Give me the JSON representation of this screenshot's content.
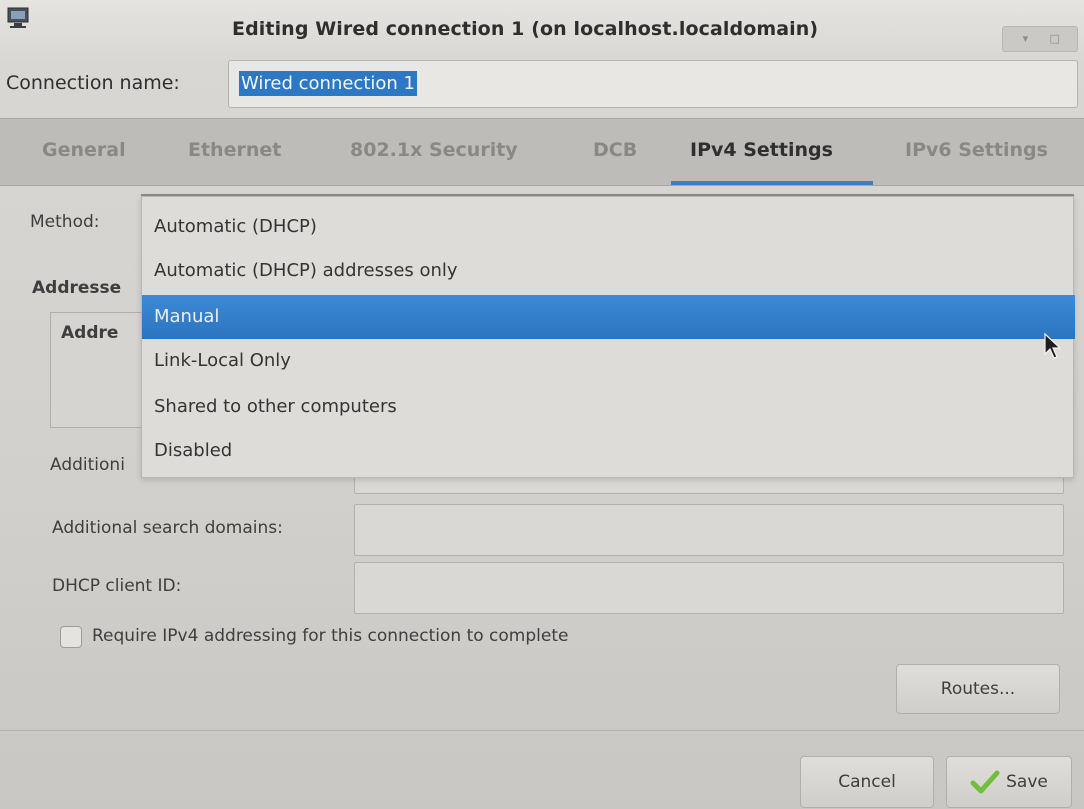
{
  "window": {
    "title": "Editing Wired connection 1 (on localhost.localdomain)"
  },
  "connection": {
    "label": "Connection name:",
    "value": "Wired connection 1"
  },
  "tabs": [
    {
      "label": "General"
    },
    {
      "label": "Ethernet"
    },
    {
      "label": "802.1x Security"
    },
    {
      "label": "DCB"
    },
    {
      "label": "IPv4 Settings",
      "active": true
    },
    {
      "label": "IPv6 Settings"
    }
  ],
  "ipv4": {
    "method_label": "Method:",
    "addresses_label_partial": "Addresse",
    "address_column_partial": "Addre",
    "additional_dns_partial": "Additioni",
    "search_domains_label": "Additional search domains:",
    "dhcp_client_id_label": "DHCP client ID:",
    "require_label": "Require IPv4 addressing for this connection to complete",
    "routes_button": "Routes..."
  },
  "method_dropdown": {
    "options": [
      "Automatic (DHCP)",
      "Automatic (DHCP) addresses only",
      "Manual",
      "Link-Local Only",
      "Shared to other computers",
      "Disabled"
    ],
    "highlighted": "Manual"
  },
  "footer": {
    "cancel_button": "Cancel",
    "save_button": "Save"
  },
  "colors": {
    "accent": "#2c78c4",
    "highlight": "#3d8ad6",
    "save_check": "#6fbf3a"
  }
}
